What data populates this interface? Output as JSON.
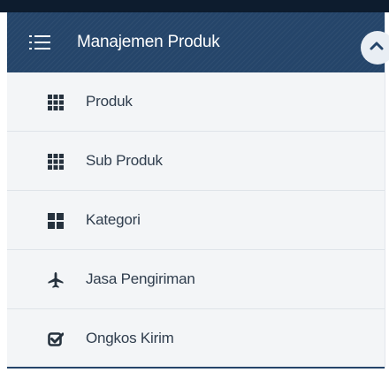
{
  "menu": {
    "header": {
      "title": "Manajemen Produk",
      "icon": "list-icon",
      "toggle_icon": "chevron-up-icon"
    },
    "items": [
      {
        "label": "Produk",
        "icon": "grid-3x3-icon"
      },
      {
        "label": "Sub Produk",
        "icon": "grid-3x3-icon"
      },
      {
        "label": "Kategori",
        "icon": "grid-2x2-icon"
      },
      {
        "label": "Jasa Pengiriman",
        "icon": "plane-icon"
      },
      {
        "label": "Ongkos Kirim",
        "icon": "check-square-icon"
      }
    ]
  },
  "colors": {
    "header_bg": "#25456a",
    "top_strip": "#0d1c2e",
    "item_bg": "#f3f5f7",
    "item_text": "#2f3d4d",
    "icon": "#26323e"
  }
}
